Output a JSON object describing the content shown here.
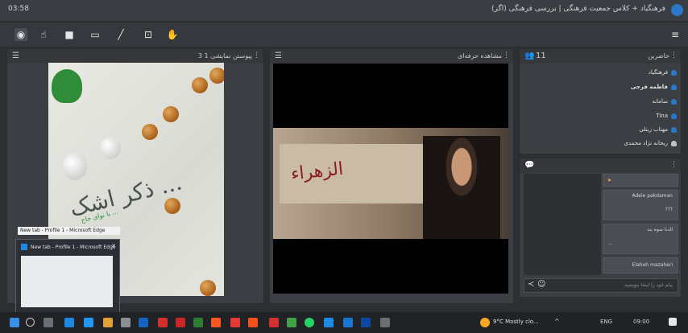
{
  "titlebar": {
    "clock": "03:58",
    "title": "فرهنگیاد + کلاس جمعیت فرهنگی | بررسی فرهنگی (اگر)",
    "avatar_icon": "user-avatar"
  },
  "toolbar": {
    "tools": [
      "share-icon",
      "pointer-icon",
      "webcam-icon",
      "screen-share-icon",
      "pen-icon",
      "whiteboard-icon",
      "raise-hand-icon"
    ],
    "menu_icon": "hamburger-icon"
  },
  "share_pod": {
    "title": "پیوستن نمایشی 1 3",
    "slide_text": "ذکر اشک ...",
    "slide_sub": "با نوای حاج ..."
  },
  "video_pod": {
    "title": "مشاهده حرفه‌ای",
    "banner_text": "الزهراء"
  },
  "attendees": {
    "title": "حاضرین",
    "count": "11",
    "users": [
      "فرهنگیاد",
      "فاطمه فرجی",
      "سامانه",
      "Tina",
      "مهتاب زینلی",
      "ریحانه نژاد محمدی"
    ]
  },
  "chat": {
    "messages": [
      {
        "name": "Adele pakdaman",
        "text": "???"
      },
      {
        "name": "الدنا سوه بند",
        "text": "..."
      },
      {
        "name": "Elaheh mazaheri",
        "text": ""
      }
    ],
    "input_placeholder": "پیام خود را اینجا بنویسید"
  },
  "taskbar": {
    "tooltip": "New tab - Profile 1 - Microsoft Edge",
    "preview_title": "New tab - Profile 1 - Microsoft Edge",
    "weather": "9°C Mostly clo...",
    "time": "09:00",
    "lang": "ENG"
  }
}
